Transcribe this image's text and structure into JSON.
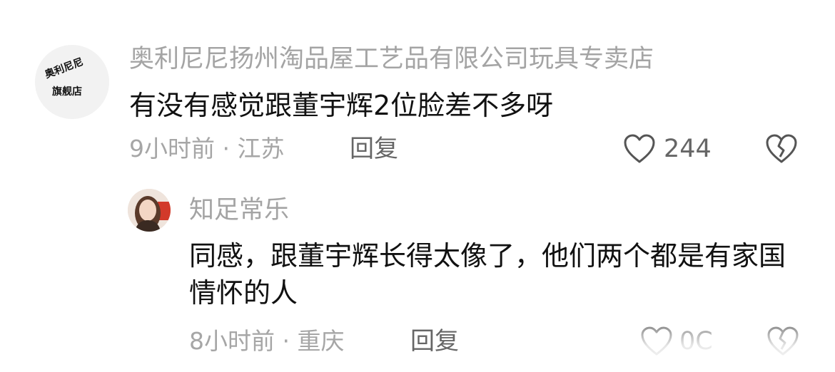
{
  "comment1": {
    "avatar_text": [
      "奥利尼尼",
      "旗舰店"
    ],
    "username": "奥利尼尼扬州淘品屋工艺品有限公司玩具专卖店",
    "text": "有没有感觉跟董宇辉2位脸差不多呀",
    "time_location": "9小时前 · 江苏",
    "reply_label": "回复",
    "like_count": "244",
    "like_icon": "heart-outline-icon",
    "dislike_icon": "broken-heart-icon"
  },
  "comment2": {
    "username": "知足常乐",
    "text": "同感，跟董宇辉长得太像了，他们两个都是有家国情怀的人",
    "time_location": "8小时前 · 重庆",
    "reply_label": "回复",
    "like_count_partial": "0C",
    "like_icon": "heart-outline-icon",
    "dislike_icon": "broken-heart-icon"
  }
}
